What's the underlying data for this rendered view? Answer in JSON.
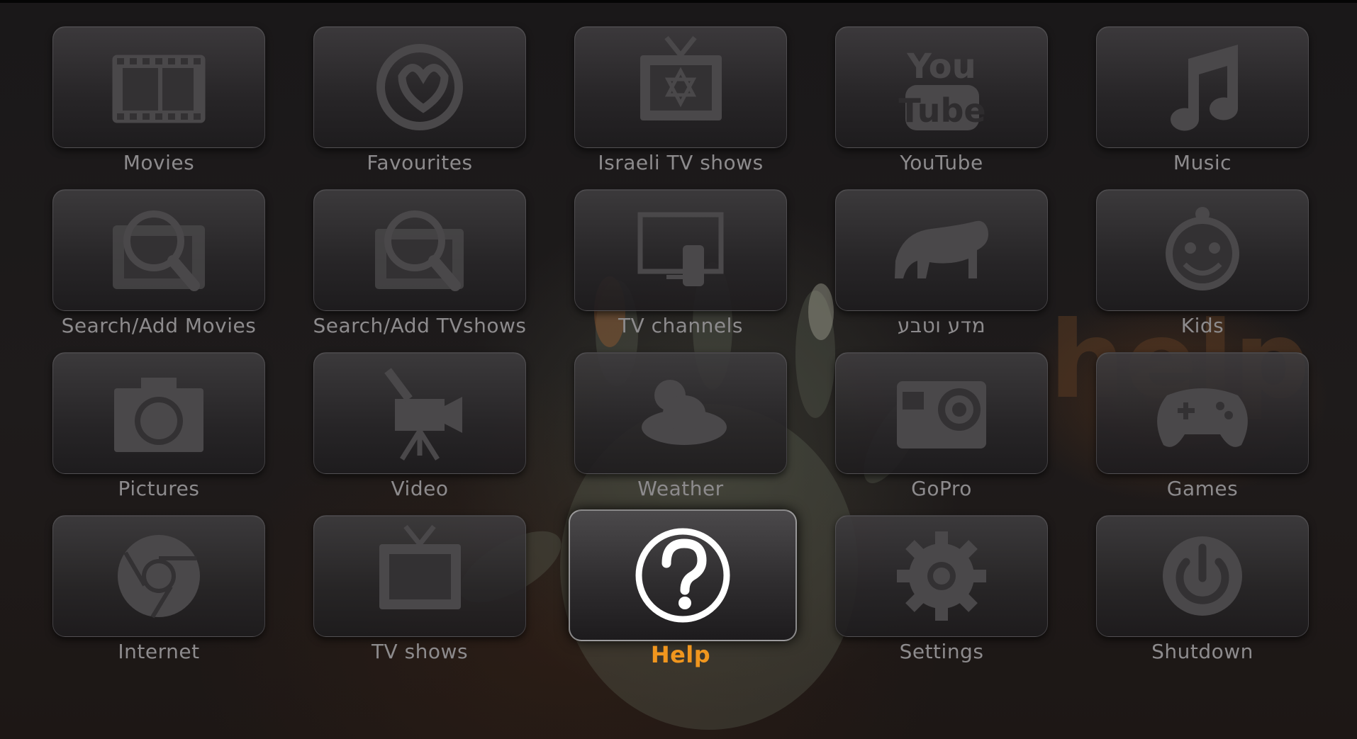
{
  "menu": {
    "focused_index": 17,
    "items": [
      {
        "label": "Movies",
        "icon": "film-strip-icon"
      },
      {
        "label": "Favourites",
        "icon": "heart-swirl-icon"
      },
      {
        "label": "Israeli TV shows",
        "icon": "tv-star-of-david-icon"
      },
      {
        "label": "YouTube",
        "icon": "youtube-logo-icon"
      },
      {
        "label": "Music",
        "icon": "music-note-icon"
      },
      {
        "label": "Search/Add Movies",
        "icon": "search-film-icon"
      },
      {
        "label": "Search/Add TVshows",
        "icon": "search-tv-icon"
      },
      {
        "label": "TV channels",
        "icon": "monitor-remote-icon"
      },
      {
        "label": "מדע וטבע",
        "icon": "tiger-icon"
      },
      {
        "label": "Kids",
        "icon": "kid-face-icon"
      },
      {
        "label": "Pictures",
        "icon": "camera-icon"
      },
      {
        "label": "Video",
        "icon": "video-camera-icon"
      },
      {
        "label": "Weather",
        "icon": "weather-sun-cloud-icon"
      },
      {
        "label": "GoPro",
        "icon": "gopro-camera-icon"
      },
      {
        "label": "Games",
        "icon": "gamepad-icon"
      },
      {
        "label": "Internet",
        "icon": "chrome-browser-icon"
      },
      {
        "label": "TV shows",
        "icon": "tv-icon"
      },
      {
        "label": "Help",
        "icon": "question-mark-icon"
      },
      {
        "label": "Settings",
        "icon": "gear-icon"
      },
      {
        "label": "Shutdown",
        "icon": "power-icon"
      }
    ]
  },
  "background": {
    "watermark_text": "help"
  },
  "colors": {
    "focus_label": "#f0961e",
    "label": "#8d8b8d",
    "icon": "#4a484a"
  }
}
